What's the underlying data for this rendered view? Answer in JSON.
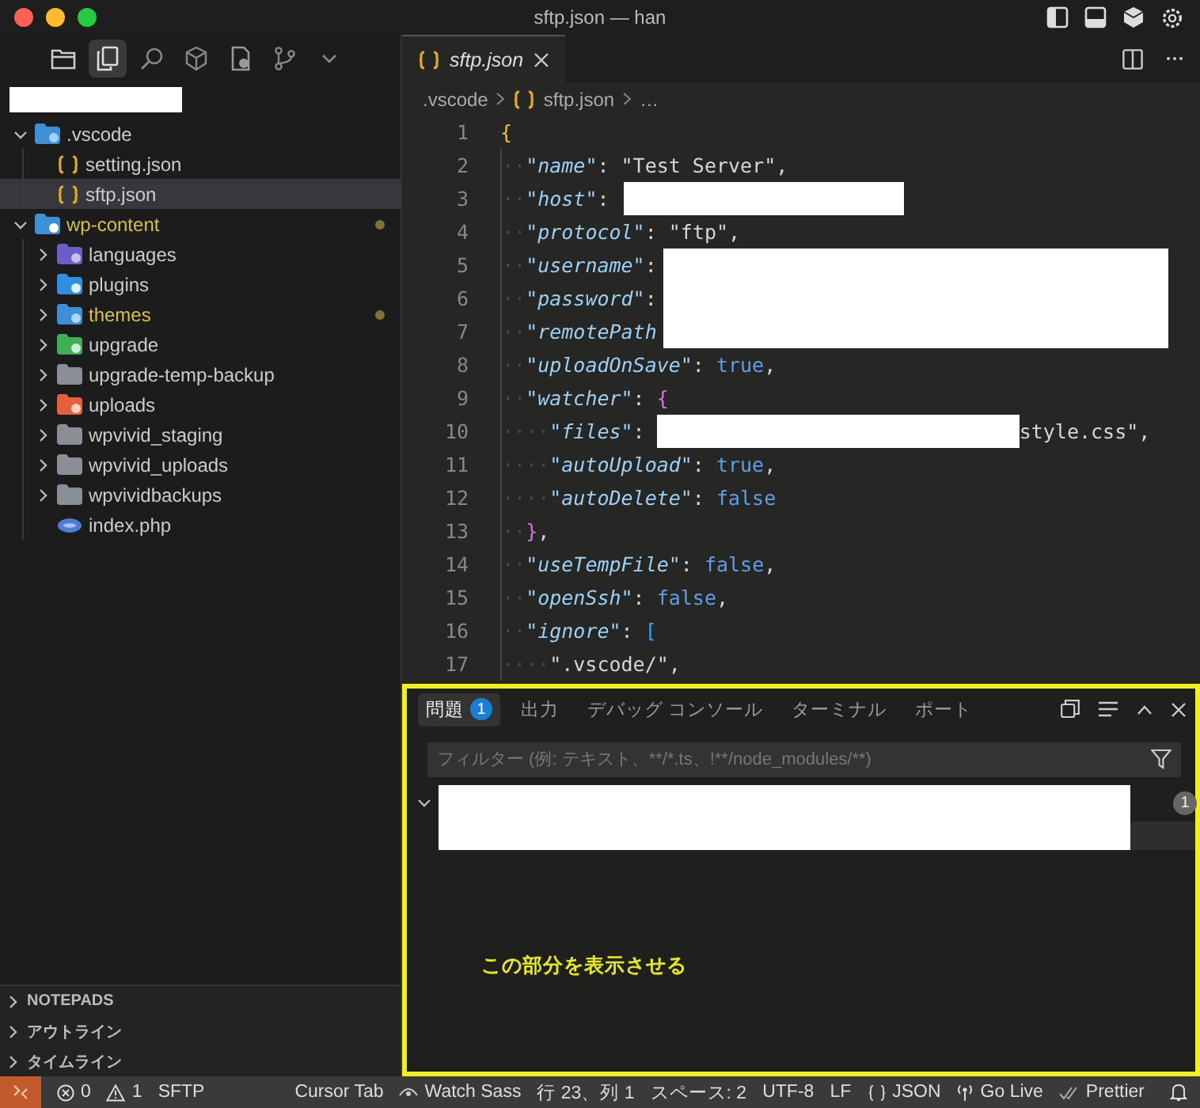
{
  "window": {
    "title": "sftp.json — han"
  },
  "activity_bar": [
    {
      "kind": "files",
      "selected": false
    },
    {
      "kind": "explorer",
      "selected": true
    },
    {
      "kind": "search",
      "selected": false
    },
    {
      "kind": "cube",
      "selected": false
    },
    {
      "kind": "remote",
      "selected": false
    },
    {
      "kind": "branch",
      "selected": false
    },
    {
      "kind": "more",
      "selected": false
    }
  ],
  "explorer": {
    "header": {
      "kind": "redacted"
    },
    "tree": [
      {
        "name": ".vscode",
        "kind": "vscode-folder",
        "expanded": true,
        "selected": false,
        "modified": false,
        "children": [
          {
            "name": "setting.json",
            "kind": "json",
            "selected": false,
            "modified": false
          },
          {
            "name": "sftp.json",
            "kind": "json",
            "selected": true,
            "modified": false
          }
        ]
      },
      {
        "name": "wp-content",
        "kind": "wp-folder",
        "expanded": true,
        "selected": false,
        "modified": true,
        "children": [
          {
            "name": "languages",
            "kind": "lang-folder",
            "expanded": false,
            "selected": false,
            "modified": false
          },
          {
            "name": "plugins",
            "kind": "plugin-folder",
            "expanded": false,
            "selected": false,
            "modified": false
          },
          {
            "name": "themes",
            "kind": "theme-folder",
            "expanded": false,
            "selected": false,
            "modified": true
          },
          {
            "name": "upgrade",
            "kind": "upgrade-folder",
            "expanded": false,
            "selected": false,
            "modified": false
          },
          {
            "name": "upgrade-temp-backup",
            "kind": "folder",
            "expanded": false,
            "selected": false,
            "modified": false
          },
          {
            "name": "uploads",
            "kind": "uploads-folder",
            "expanded": false,
            "selected": false,
            "modified": false
          },
          {
            "name": "wpvivid_staging",
            "kind": "folder",
            "expanded": false,
            "selected": false,
            "modified": false
          },
          {
            "name": "wpvivid_uploads",
            "kind": "folder",
            "expanded": false,
            "selected": false,
            "modified": false
          },
          {
            "name": "wpvividbackups",
            "kind": "folder",
            "expanded": false,
            "selected": false,
            "modified": false
          },
          {
            "name": "index.php",
            "kind": "php",
            "selected": false,
            "modified": false
          }
        ]
      }
    ]
  },
  "sections": [
    {
      "label": "NOTEPADS",
      "expanded": false
    },
    {
      "label": "アウトライン",
      "expanded": false
    },
    {
      "label": "タイムライン",
      "expanded": false
    }
  ],
  "editor_tabs": [
    {
      "label": "sftp.json",
      "selected": true
    }
  ],
  "breadcrumb": [
    {
      "label": ".vscode",
      "kind": "folder"
    },
    {
      "label": "sftp.json",
      "kind": "json"
    },
    {
      "label": "…",
      "kind": "more"
    }
  ],
  "code": [
    {
      "number": "1",
      "tokens": [
        {
          "kind": "brace",
          "text": "{"
        }
      ]
    },
    {
      "number": "2",
      "tokens": [
        {
          "kind": "ws",
          "text": "··"
        },
        {
          "kind": "key",
          "text": "\"name\""
        },
        {
          "kind": "punct",
          "text": ": "
        },
        {
          "kind": "string",
          "text": "\"Test Server\""
        },
        {
          "kind": "punct",
          "text": ","
        }
      ]
    },
    {
      "number": "3",
      "tokens": [
        {
          "kind": "ws",
          "text": "··"
        },
        {
          "kind": "key",
          "text": "\"host\""
        },
        {
          "kind": "punct",
          "text": ": "
        },
        {
          "kind": "redacted"
        }
      ]
    },
    {
      "number": "4",
      "tokens": [
        {
          "kind": "ws",
          "text": "··"
        },
        {
          "kind": "key",
          "text": "\"protocol\""
        },
        {
          "kind": "punct",
          "text": ": "
        },
        {
          "kind": "string",
          "text": "\"ftp\""
        },
        {
          "kind": "punct",
          "text": ","
        }
      ]
    },
    {
      "number": "5",
      "tokens": [
        {
          "kind": "ws",
          "text": "··"
        },
        {
          "kind": "key",
          "text": "\"username\""
        },
        {
          "kind": "punct",
          "text": ":"
        },
        {
          "kind": "redacted-wide"
        }
      ]
    },
    {
      "number": "6",
      "tokens": [
        {
          "kind": "ws",
          "text": "··"
        },
        {
          "kind": "key",
          "text": "\"password\""
        },
        {
          "kind": "punct",
          "text": ":"
        },
        {
          "kind": "redacted-wide"
        }
      ]
    },
    {
      "number": "7",
      "tokens": [
        {
          "kind": "ws",
          "text": "··"
        },
        {
          "kind": "key",
          "text": "\"remotePath"
        },
        {
          "kind": "redacted-wide"
        }
      ]
    },
    {
      "number": "8",
      "tokens": [
        {
          "kind": "ws",
          "text": "··"
        },
        {
          "kind": "key",
          "text": "\"uploadOnSave\""
        },
        {
          "kind": "punct",
          "text": ": "
        },
        {
          "kind": "bool",
          "text": "true"
        },
        {
          "kind": "punct",
          "text": ","
        }
      ]
    },
    {
      "number": "9",
      "tokens": [
        {
          "kind": "ws",
          "text": "··"
        },
        {
          "kind": "key",
          "text": "\"watcher\""
        },
        {
          "kind": "punct",
          "text": ": "
        },
        {
          "kind": "brace2",
          "text": "{"
        }
      ]
    },
    {
      "number": "10",
      "tokens": [
        {
          "kind": "ws",
          "text": "····"
        },
        {
          "kind": "key",
          "text": "\"files\""
        },
        {
          "kind": "punct",
          "text": ": "
        },
        {
          "kind": "redacted-long"
        },
        {
          "kind": "string",
          "text": "style.css\""
        },
        {
          "kind": "punct",
          "text": ","
        }
      ]
    },
    {
      "number": "11",
      "tokens": [
        {
          "kind": "ws",
          "text": "····"
        },
        {
          "kind": "key",
          "text": "\"autoUpload\""
        },
        {
          "kind": "punct",
          "text": ": "
        },
        {
          "kind": "bool",
          "text": "true"
        },
        {
          "kind": "punct",
          "text": ","
        }
      ]
    },
    {
      "number": "12",
      "tokens": [
        {
          "kind": "ws",
          "text": "····"
        },
        {
          "kind": "key",
          "text": "\"autoDelete\""
        },
        {
          "kind": "punct",
          "text": ": "
        },
        {
          "kind": "bool",
          "text": "false"
        }
      ]
    },
    {
      "number": "13",
      "tokens": [
        {
          "kind": "ws",
          "text": "··"
        },
        {
          "kind": "brace2",
          "text": "}"
        },
        {
          "kind": "punct",
          "text": ","
        }
      ]
    },
    {
      "number": "14",
      "tokens": [
        {
          "kind": "ws",
          "text": "··"
        },
        {
          "kind": "key",
          "text": "\"useTempFile\""
        },
        {
          "kind": "punct",
          "text": ": "
        },
        {
          "kind": "bool",
          "text": "false"
        },
        {
          "kind": "punct",
          "text": ","
        }
      ]
    },
    {
      "number": "15",
      "tokens": [
        {
          "kind": "ws",
          "text": "··"
        },
        {
          "kind": "key",
          "text": "\"openSsh\""
        },
        {
          "kind": "punct",
          "text": ": "
        },
        {
          "kind": "bool",
          "text": "false"
        },
        {
          "kind": "punct",
          "text": ","
        }
      ]
    },
    {
      "number": "16",
      "tokens": [
        {
          "kind": "ws",
          "text": "··"
        },
        {
          "kind": "key",
          "text": "\"ignore\""
        },
        {
          "kind": "punct",
          "text": ": "
        },
        {
          "kind": "brace3",
          "text": "["
        }
      ]
    },
    {
      "number": "17",
      "tokens": [
        {
          "kind": "ws",
          "text": "····"
        },
        {
          "kind": "string",
          "text": "\".vscode/\""
        },
        {
          "kind": "punct",
          "text": ","
        }
      ]
    }
  ],
  "panel": {
    "tabs": [
      {
        "label": "問題",
        "badge": "1",
        "selected": true
      },
      {
        "label": "出力",
        "selected": false
      },
      {
        "label": "デバッグ コンソール",
        "selected": false
      },
      {
        "label": "ターミナル",
        "selected": false
      },
      {
        "label": "ポート",
        "selected": false
      }
    ],
    "filter": {
      "placeholder": "フィルター (例: テキスト、**/*.ts、!**/node_modules/**)"
    },
    "problems": [
      {
        "kind": "redacted",
        "count": "1",
        "expanded": true
      }
    ],
    "annotation": "この部分を表示させる"
  },
  "status_bar": [
    {
      "kind": "errors",
      "text": "0"
    },
    {
      "kind": "warnings",
      "text": "1"
    },
    {
      "kind": "plain",
      "text": "SFTP"
    },
    {
      "kind": "gap"
    },
    {
      "kind": "plain",
      "text": "Cursor Tab"
    },
    {
      "kind": "eye",
      "text": "Watch Sass"
    },
    {
      "kind": "plain",
      "text": "行 23、列 1"
    },
    {
      "kind": "plain",
      "text": "スペース: 2"
    },
    {
      "kind": "plain",
      "text": "UTF-8"
    },
    {
      "kind": "plain",
      "text": "LF"
    },
    {
      "kind": "braces",
      "text": "JSON"
    },
    {
      "kind": "broadcast",
      "text": "Go Live"
    },
    {
      "kind": "check",
      "text": "Prettier"
    },
    {
      "kind": "bell"
    }
  ]
}
